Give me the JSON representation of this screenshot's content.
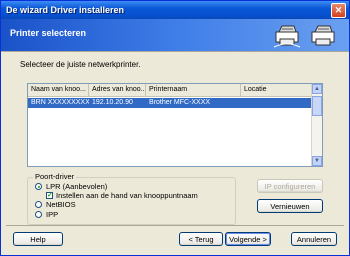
{
  "window": {
    "title": "De wizard Driver installeren",
    "close_glyph": "✕"
  },
  "banner": {
    "title": "Printer selecteren",
    "icons": [
      "printer-network-icon",
      "printer-icon"
    ]
  },
  "instruction": "Selecteer de juiste netwerkprinter.",
  "list": {
    "columns": [
      "Naam van knoo...",
      "Adres van knoo...",
      "Printernaam",
      "Locatie"
    ],
    "rows": [
      {
        "node_name": "BRN XXXXXXXXX",
        "address": "192.10.20.90",
        "printer": "Brother  MFC-XXXX",
        "location": ""
      }
    ]
  },
  "port_driver": {
    "title": "Poort-driver",
    "options": [
      {
        "label": "LPR (Aanbevolen)",
        "selected": true
      },
      {
        "label": "NetBIOS",
        "selected": false
      },
      {
        "label": "IPP",
        "selected": false
      }
    ],
    "checkbox_label": "Instellen aan de hand van knooppuntnaam",
    "checkbox_checked": true
  },
  "buttons": {
    "configure": "IP configureren",
    "refresh": "Vernieuwen",
    "help": "Help",
    "back": "< Terug",
    "next": "Volgende >",
    "cancel": "Annuleren"
  },
  "colors": {
    "title_bar": "#0a58d6",
    "banner": "#3f7de8",
    "selection": "#316ac5",
    "dialog": "#ece9d8"
  }
}
